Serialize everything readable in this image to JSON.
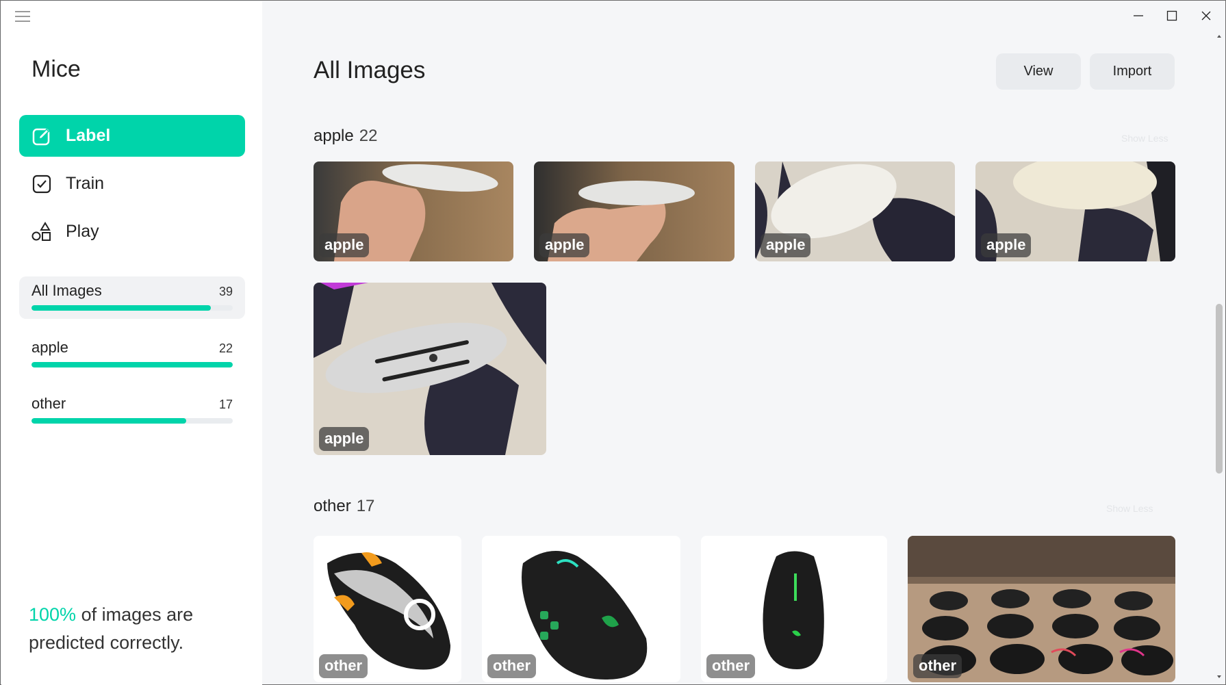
{
  "app": {
    "title": "Mice"
  },
  "nav": [
    {
      "label": "Label",
      "icon": "edit-icon",
      "active": true
    },
    {
      "label": "Train",
      "icon": "checkbox-icon",
      "active": false
    },
    {
      "label": "Play",
      "icon": "shapes-icon",
      "active": false
    }
  ],
  "categories": [
    {
      "name": "All Images",
      "count": "39",
      "progress": 0.89
    },
    {
      "name": "apple",
      "count": "22",
      "progress": 1.0
    },
    {
      "name": "other",
      "count": "17",
      "progress": 0.77
    }
  ],
  "accuracy": {
    "percent": "100%",
    "text_a": " of images are",
    "text_b": "predicted correctly."
  },
  "main": {
    "title": "All Images",
    "view_label": "View",
    "import_label": "Import",
    "show_less": "Show Less"
  },
  "sections": [
    {
      "name": "apple",
      "count": "22",
      "tags": [
        "apple",
        "apple",
        "apple",
        "apple",
        "apple"
      ]
    },
    {
      "name": "other",
      "count": "17",
      "tags": [
        "other",
        "other",
        "other",
        "other"
      ]
    }
  ],
  "colors": {
    "accent": "#00d4aa",
    "background": "#f5f6f8",
    "sidebar": "#ffffff"
  }
}
